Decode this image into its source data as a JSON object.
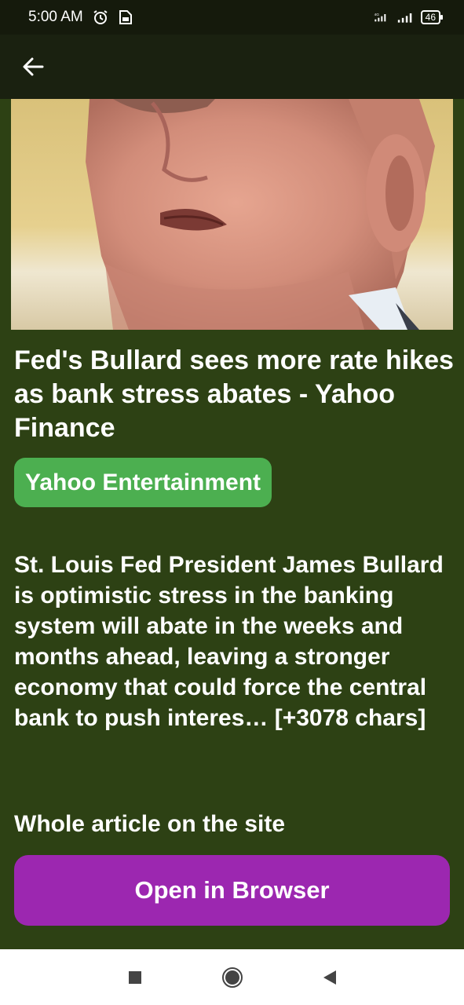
{
  "status_bar": {
    "time": "5:00 AM",
    "network": "4G",
    "battery": "46",
    "icons": [
      "alarm-icon",
      "sim-icon",
      "signal-4g-icon",
      "signal-icon",
      "battery-icon"
    ]
  },
  "app_bar": {
    "back_icon": "arrow-left-icon"
  },
  "article": {
    "image_description_icon": "news-photo",
    "title": "Fed's Bullard sees more rate hikes as bank stress abates - Yahoo Finance",
    "source": "Yahoo Entertainment",
    "description": "St. Louis Fed President James Bullard is optimistic stress in the banking system will abate in the weeks and months ahead, leaving a stronger economy that could force the central bank to push interes… [+3078 chars]",
    "whole_article_label": "Whole article on the site",
    "open_button_label": "Open in Browser"
  },
  "nav_bar": {
    "icons": [
      "recents-square-icon",
      "home-circle-icon",
      "back-triangle-icon"
    ]
  },
  "colors": {
    "background": "#2d4114",
    "app_bar": "#1a2110",
    "status_bar": "#151a0c",
    "badge": "#4caf50",
    "button": "#9c27b0"
  }
}
